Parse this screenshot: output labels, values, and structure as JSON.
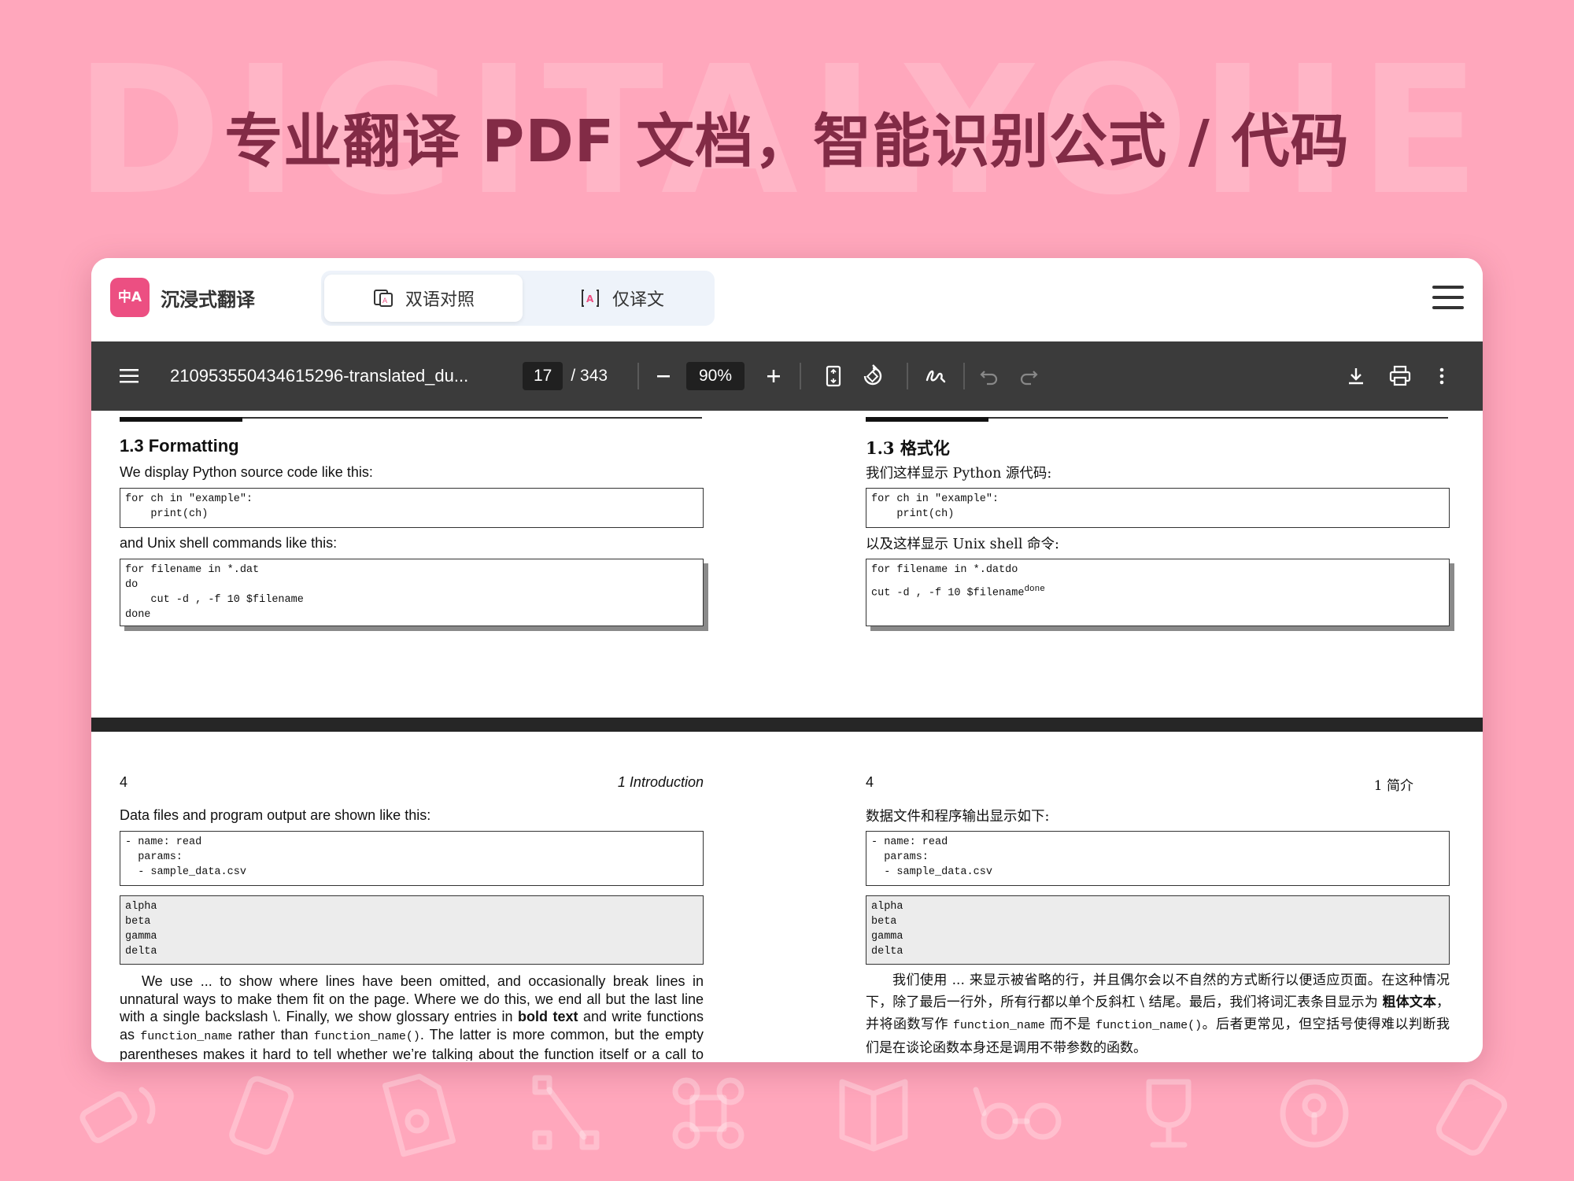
{
  "banner": {
    "watermark": "DIGITALYOHEE",
    "headline": "专业翻译 PDF 文档，智能识别公式 / 代码"
  },
  "app": {
    "logo_text": "中A",
    "name": "沉浸式翻译",
    "modes": {
      "bilingual": "双语对照",
      "translation_only": "仅译文"
    }
  },
  "toolbar": {
    "filename": "2109535504346152​96-translated_du...",
    "page_current": "17",
    "page_total": "/ 343",
    "zoom": "90%",
    "icons": [
      "menu-icon",
      "zoom-out-icon",
      "zoom-in-icon",
      "fit-page-icon",
      "rotate-icon",
      "draw-icon",
      "undo-icon",
      "redo-icon",
      "download-icon",
      "print-icon",
      "more-icon"
    ]
  },
  "page_top": {
    "left": {
      "section": "1.3   Formatting",
      "intro": "We display Python source code like this:",
      "code1": "for ch in \"example\":\n    print(ch)",
      "shell_intro": "and Unix shell commands like this:",
      "code2": "for filename in *.dat\ndo\n    cut -d , -f 10 $filename\ndone"
    },
    "right": {
      "section": "1.3 格式化",
      "intro": "我们这样显示 Python 源代码:",
      "code1": "for ch in \"example\":\n    print(ch)",
      "shell_intro": "以及这样显示 Unix shell 命令:",
      "code2_line1": "for filename in *.datdo",
      "code2_line2": "cut -d , -f 10 $filename",
      "code2_sup": "done"
    }
  },
  "page_bottom": {
    "left": {
      "page_num": "4",
      "chapter": "1  Introduction",
      "intro": "Data files and program output are shown like this:",
      "code1": "- name: read\n  params:\n  - sample_data.csv",
      "code2": "alpha\nbeta\ngamma\ndelta",
      "body_1": "We use ... to show where lines have been omitted, and occasionally break lines in unnatural ways to make them fit on the page. Where we do this, we end all but the last line with a single backslash \\. Finally, we show glossary entries in ",
      "body_bold": "bold text",
      "body_2": " and write functions as ",
      "body_code1": "function_name",
      "body_3": " rather than ",
      "body_code2": "function_name()",
      "body_4": ". The latter is more common, but the empty parentheses makes it hard to tell whether we’re talking about the function itself or a call to the function with no parameters."
    },
    "right": {
      "page_num": "4",
      "chapter": "1 简介",
      "intro": "数据文件和程序输出显示如下:",
      "code1": "- name: read\n  params:\n  - sample_data.csv",
      "code2": "alpha\nbeta\ngamma\ndelta",
      "body_1": "我们使用 ... 来显示被省略的行，并且偶尔会以不自然的方式断行以便适应页面。在这种情况下，除了最后一行外，所有行都以单个反斜杠 \\ 结尾。最后，我们将词汇表条目显示为 ",
      "body_bold": "粗体文本",
      "body_2": "，并将函数写作 ",
      "body_code1": "function_name",
      "body_3": " 而不是 ",
      "body_code2": "function_name()",
      "body_4": "。后者更常见，但空括号使得难以判断我们是在谈论函数本身还是调用不带参数的函数。"
    }
  }
}
